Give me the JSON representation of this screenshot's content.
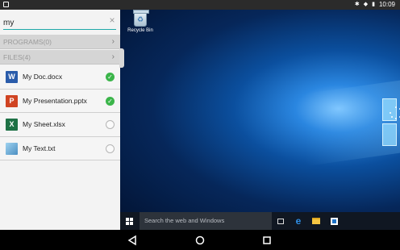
{
  "status_bar": {
    "time": "10:09",
    "icons": [
      "app-icon",
      "bluetooth-icon",
      "wifi-icon",
      "battery-icon"
    ]
  },
  "search": {
    "value": "my",
    "clear_icon": "close-icon"
  },
  "sections": {
    "programs": "PROGRAMS(0)",
    "files": "FILES(4)"
  },
  "files": [
    {
      "name": "My Doc.docx",
      "icon": "word-icon",
      "checked": true
    },
    {
      "name": "My Presentation.pptx",
      "icon": "powerpoint-icon",
      "checked": true
    },
    {
      "name": "My Sheet.xlsx",
      "icon": "excel-icon",
      "checked": false
    },
    {
      "name": "My Text.txt",
      "icon": "text-file-icon",
      "checked": false
    }
  ],
  "desktop": {
    "recycle_bin_label": "Recycle Bin"
  },
  "taskbar": {
    "search_placeholder": "Search the web and Windows",
    "icons": [
      "start-icon",
      "task-view-icon",
      "edge-icon",
      "file-explorer-icon",
      "store-icon"
    ]
  },
  "nav_bar": {
    "icons": [
      "back-icon",
      "home-icon",
      "recent-apps-icon"
    ]
  },
  "colors": {
    "accent": "#1fa8a8",
    "check_on": "#3bb54a",
    "section_bg": "#d5d5d5",
    "taskbar_bg": "#101722"
  }
}
